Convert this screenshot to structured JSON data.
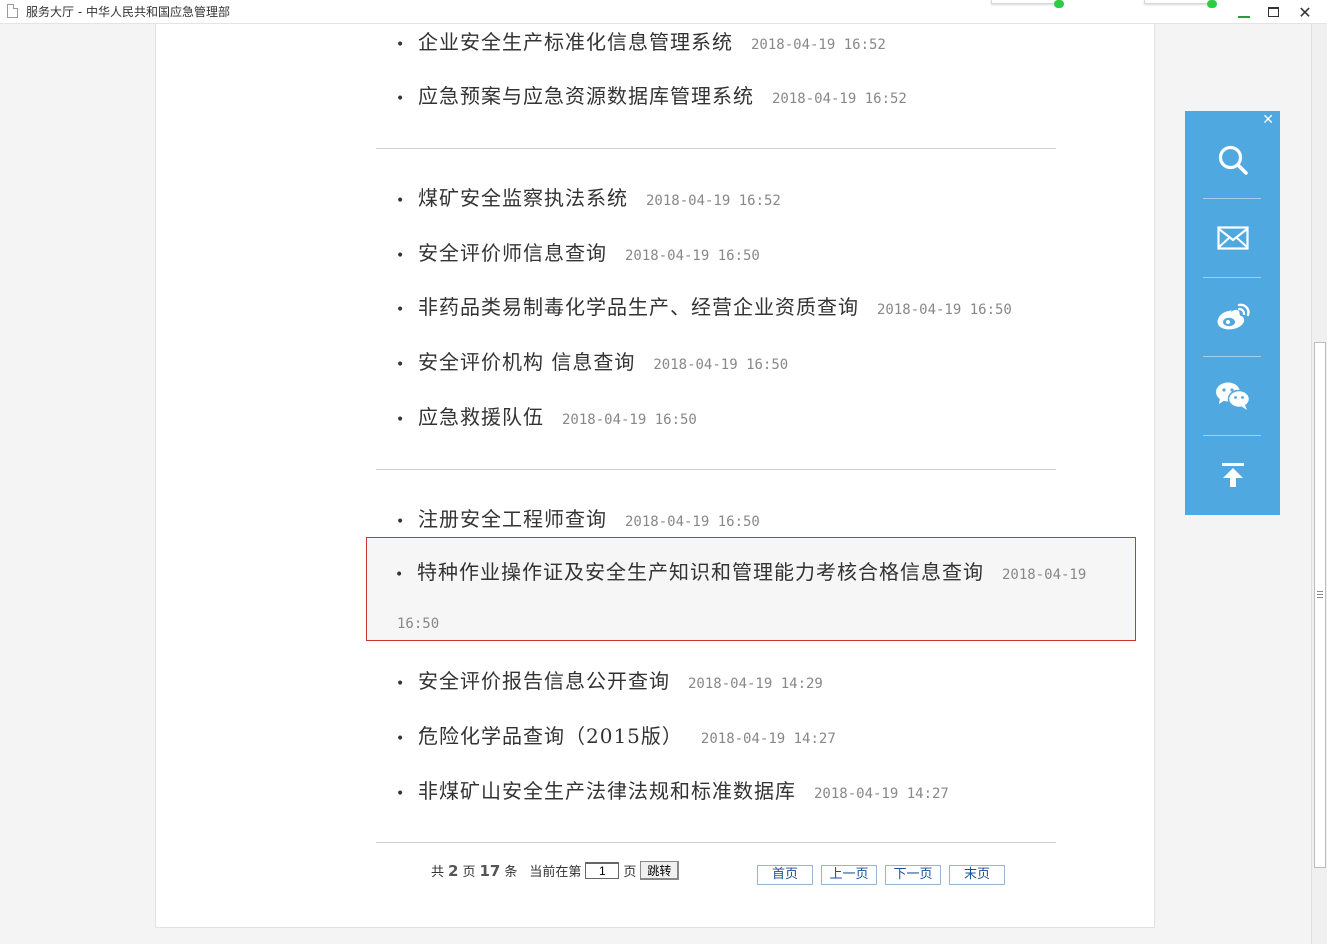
{
  "window": {
    "title": "服务大厅 - 中华人民共和国应急管理部",
    "minimize_label": "—",
    "close_label": "✕"
  },
  "groups": [
    {
      "items": [
        {
          "name": "企业安全生产标准化信息管理系统",
          "date": "2018-04-19 16:52"
        },
        {
          "name": "应急预案与应急资源数据库管理系统",
          "date": "2018-04-19 16:52"
        }
      ]
    },
    {
      "items": [
        {
          "name": "煤矿安全监察执法系统",
          "date": "2018-04-19 16:52"
        },
        {
          "name": "安全评价师信息查询",
          "date": "2018-04-19 16:50"
        },
        {
          "name": "非药品类易制毒化学品生产、经营企业资质查询",
          "date": "2018-04-19 16:50"
        },
        {
          "name": "安全评价机构 信息查询",
          "date": "2018-04-19 16:50"
        },
        {
          "name": "应急救援队伍",
          "date": "2018-04-19 16:50"
        }
      ]
    },
    {
      "items": [
        {
          "name": "注册安全工程师查询",
          "date": "2018-04-19 16:50"
        },
        {
          "name": "特种作业操作证及安全生产知识和管理能力考核合格信息查询",
          "date": "2018-04-19",
          "date_wrap": "16:50"
        },
        {
          "name": "安全评价报告信息公开查询",
          "date": "2018-04-19 14:29"
        },
        {
          "name": "危险化学品查询（2015版）",
          "date": "2018-04-19 14:27"
        },
        {
          "name": "非煤矿山安全生产法律法规和标准数据库",
          "date": "2018-04-19 14:27"
        }
      ]
    }
  ],
  "bullet": "•",
  "pager": {
    "total_prefix": "共",
    "total_pages": "2",
    "pages_unit": "页",
    "total_items": "17",
    "items_unit": "条",
    "current_prefix": "当前在第",
    "current_page": "1",
    "current_suffix": "页",
    "jump_label": "跳转",
    "first_label": "首页",
    "prev_label": "上一页",
    "next_label": "下一页",
    "last_label": "末页"
  },
  "side_toolbar": {
    "close_label": "✕",
    "icons": [
      "search-icon",
      "mail-icon",
      "weibo-icon",
      "wechat-icon",
      "back-to-top-icon"
    ],
    "color": "#4fa9e0"
  },
  "colors": {
    "highlight_border": "#cc3333",
    "link": "#1a4f9c"
  }
}
